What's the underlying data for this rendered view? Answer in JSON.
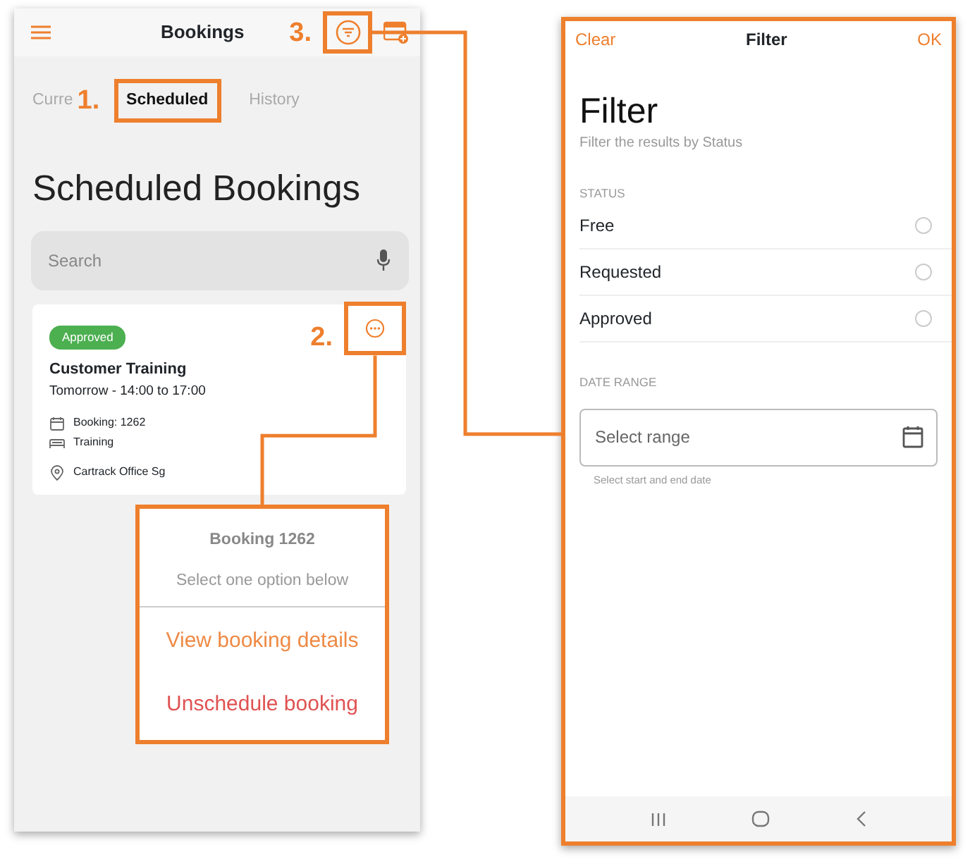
{
  "bookings_screen": {
    "title": "Bookings",
    "tabs": [
      {
        "label": "Curre",
        "selected": false
      },
      {
        "label": "Scheduled",
        "selected": true
      },
      {
        "label": "History",
        "selected": false
      }
    ],
    "heading": "Scheduled Bookings",
    "search": {
      "placeholder": "Search"
    },
    "booking_card": {
      "status": "Approved",
      "title": "Customer Training",
      "time": "Tomorrow - 14:00 to 17:00",
      "details": [
        {
          "kind": "booking",
          "text": "Booking: 1262"
        },
        {
          "kind": "type",
          "text": "Training"
        },
        {
          "kind": "location",
          "text": "Cartrack Office Sg"
        }
      ]
    },
    "options_sheet": {
      "title": "Booking 1262",
      "subtitle": "Select one option below",
      "options": [
        {
          "label": "View booking details",
          "kind": "normal"
        },
        {
          "label": "Unschedule booking",
          "kind": "destructive"
        }
      ]
    }
  },
  "filter_screen": {
    "left_action": "Clear",
    "title": "Filter",
    "right_action": "OK",
    "heading": "Filter",
    "subtitle": "Filter the results by Status",
    "status_label": "STATUS",
    "statuses": [
      {
        "label": "Free",
        "selected": false
      },
      {
        "label": "Requested",
        "selected": false
      },
      {
        "label": "Approved",
        "selected": false
      }
    ],
    "date_range_label": "DATE RANGE",
    "date_field": {
      "placeholder": "Select range",
      "hint": "Select start and end date"
    }
  },
  "callouts": [
    {
      "label": "1."
    },
    {
      "label": "2."
    },
    {
      "label": "3."
    }
  ]
}
